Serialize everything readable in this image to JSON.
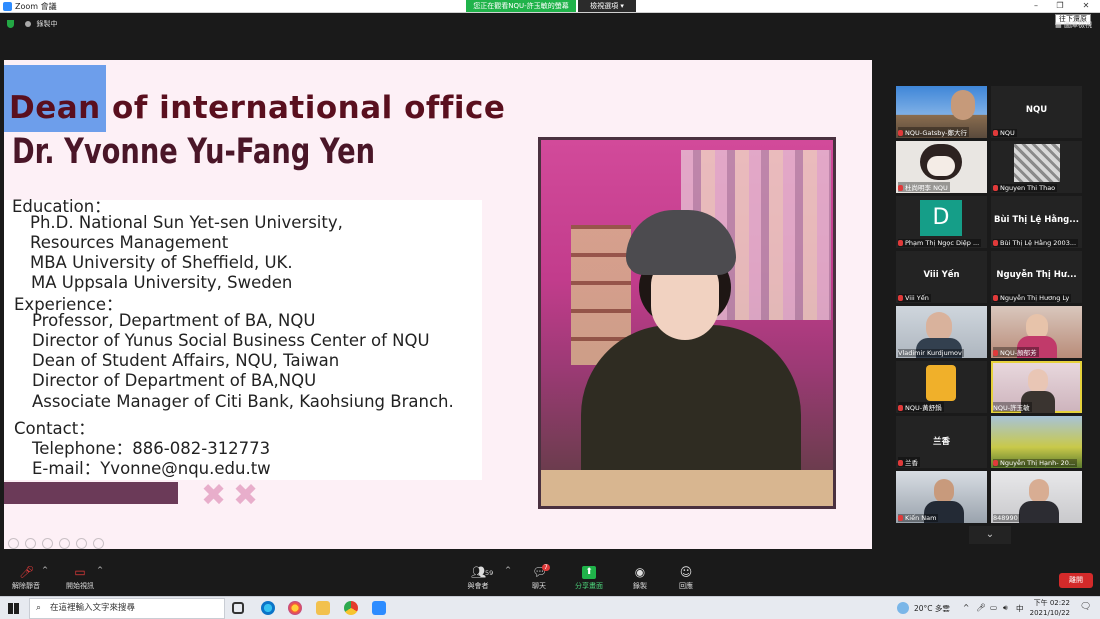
{
  "window": {
    "title": "Zoom 會議",
    "share_banner": "您正在觀看NQU-許玉敏的螢幕",
    "view_options": "檢視選項",
    "tooltip": "往下還原",
    "gallery_view": "圖庫檢視"
  },
  "status": {
    "recording": "錄製中"
  },
  "slide": {
    "heading_highlight": "Dean",
    "heading_rest": " of international office",
    "name": "Dr. Yvonne Yu-Fang Yen",
    "lines": [
      "Education：",
      "Ph.D. National Sun Yet-sen University,",
      "Resources Management",
      "MBA University of Sheffield, UK.",
      "MA Uppsala University, Sweden",
      "Experience：",
      "Professor, Department of BA, NQU",
      "Director of Yunus Social Business Center of NQU",
      "Dean of Student Affairs, NQU, Taiwan",
      "Director of Department of BA,NQU",
      "Associate Manager of Citi Bank, Kaohsiung Branch.",
      "Contact：",
      "Telephone：886-082-312773",
      "E-mail：Yvonne@nqu.edu.tw"
    ]
  },
  "participants": [
    {
      "center": "",
      "label": "NQU-Gatsby-鄭大行"
    },
    {
      "center": "NQU",
      "label": "NQU"
    },
    {
      "center": "",
      "label": "杜尚明李 NQU"
    },
    {
      "center": "",
      "label": "Nguyen Thi Thao"
    },
    {
      "center": "D",
      "label": "Phạm Thị Ngọc Diệp ..."
    },
    {
      "center": "Bùi Thị Lệ Hằng...",
      "label": "Bùi Thị Lệ Hằng 2003..."
    },
    {
      "center": "Viii Yến",
      "label": "Viii Yến"
    },
    {
      "center": "Nguyễn Thị Hư...",
      "label": "Nguyễn Thị Hương Ly"
    },
    {
      "center": "",
      "label": "Vladimir Kurdjumov"
    },
    {
      "center": "",
      "label": "NQU-顏郁芳"
    },
    {
      "center": "",
      "label": "NQU-黃舒鍋"
    },
    {
      "center": "",
      "label": "NQU-許玉敏"
    },
    {
      "center": "兰香",
      "label": "兰香"
    },
    {
      "center": "",
      "label": "Nguyễn Thị Hạnh- 20..."
    },
    {
      "center": "",
      "label": "Kiến Nam"
    },
    {
      "center": "",
      "label": "848990"
    }
  ],
  "toolbar": {
    "unmute": "解除靜音",
    "start_video": "開始視訊",
    "participants": "與會者",
    "participants_count": "59",
    "chat": "聊天",
    "chat_badge": "7",
    "share_screen": "分享畫面",
    "record": "錄製",
    "reactions": "回應",
    "leave": "離開"
  },
  "taskbar": {
    "search_placeholder": "在這裡輸入文字來搜尋",
    "weather": "20°C 多雲",
    "time": "下午 02:22",
    "date": "2021/10/22"
  },
  "colors": {
    "slide_bg": "#fdf0f6",
    "heading": "#5a0f1e",
    "highlight": "#6d9eeb",
    "share_green": "#20b34a",
    "leave_red": "#d42a2a"
  }
}
